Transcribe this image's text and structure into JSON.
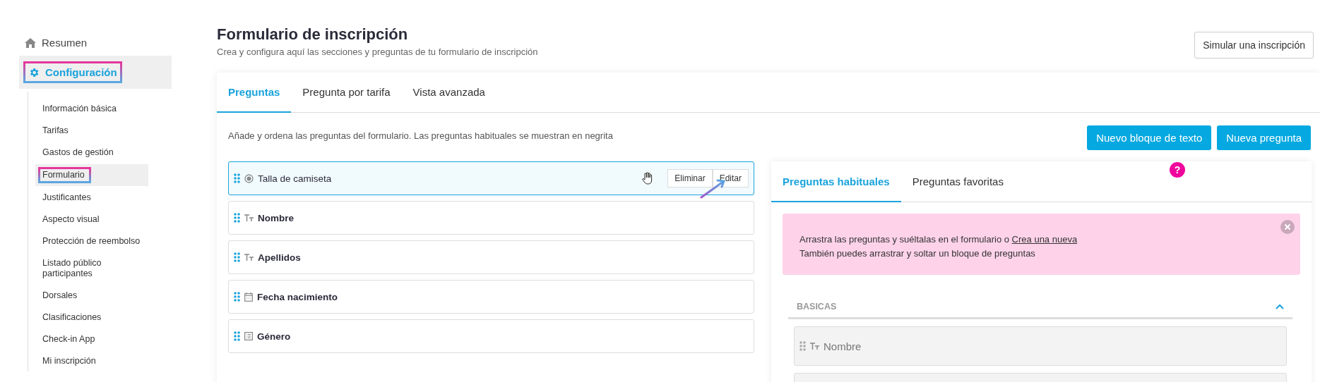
{
  "sidebar": {
    "items": [
      {
        "label": "Resumen",
        "selected": false,
        "annotated": false
      },
      {
        "label": "Configuración",
        "selected": true,
        "annotated": true,
        "expanded": true,
        "children": [
          {
            "label": "Información básica",
            "selected": false,
            "annotated": false
          },
          {
            "label": "Tarifas",
            "selected": false,
            "annotated": false
          },
          {
            "label": "Gastos de gestión",
            "selected": false,
            "annotated": false
          },
          {
            "label": "Formulario",
            "selected": true,
            "annotated": true
          },
          {
            "label": "Justificantes",
            "selected": false,
            "annotated": false
          },
          {
            "label": "Aspecto visual",
            "selected": false,
            "annotated": false
          },
          {
            "label": "Protección de reembolso",
            "selected": false,
            "annotated": false
          },
          {
            "label": "Listado público participantes",
            "selected": false,
            "annotated": false
          },
          {
            "label": "Dorsales",
            "selected": false,
            "annotated": false
          },
          {
            "label": "Clasificaciones",
            "selected": false,
            "annotated": false
          },
          {
            "label": "Check-in App",
            "selected": false,
            "annotated": false
          },
          {
            "label": "Mi inscripción",
            "selected": false,
            "annotated": false
          }
        ]
      }
    ]
  },
  "header": {
    "title": "Formulario de inscripción",
    "subtitle": "Crea y configura aquí las secciones y preguntas de tu formulario de inscripción",
    "button": "Simular una inscripción"
  },
  "tabs": [
    {
      "label": "Preguntas",
      "selected": true
    },
    {
      "label": "Pregunta por tarifa",
      "selected": false
    },
    {
      "label": "Vista avanzada",
      "selected": false
    }
  ],
  "description": "Añade y ordena las preguntas del formulario. Las preguntas habituales se muestran en negrita",
  "actions": [
    "Nuevo bloque de texto",
    "Nueva pregunta"
  ],
  "questions": [
    {
      "label": "Talla de camiseta",
      "kind": "radio",
      "habitual": false,
      "selected": true,
      "annotated": true,
      "buttons": [
        "Eliminar",
        "Editar"
      ]
    },
    {
      "label": "Nombre",
      "kind": "text",
      "habitual": true,
      "selected": false,
      "annotated": false
    },
    {
      "label": "Apellidos",
      "kind": "text",
      "habitual": true,
      "selected": false,
      "annotated": false
    },
    {
      "label": "Fecha nacimiento",
      "kind": "date",
      "habitual": true,
      "selected": false,
      "annotated": false
    },
    {
      "label": "Género",
      "kind": "list",
      "habitual": true,
      "selected": false,
      "annotated": false
    }
  ],
  "help_badge": "?",
  "library": {
    "tabs": [
      {
        "label": "Preguntas habituales",
        "selected": true
      },
      {
        "label": "Preguntas favoritas",
        "selected": false
      }
    ],
    "alert": {
      "line_1": "Arrastra las preguntas y suéltalas en el formulario o",
      "link": "Crea una nueva",
      "line_2": "También puedes arrastrar y soltar un bloque de preguntas"
    },
    "sections": [
      {
        "title": "BASICAS",
        "expanded": true,
        "items": [
          {
            "label": "Nombre",
            "kind": "text"
          }
        ]
      }
    ]
  }
}
